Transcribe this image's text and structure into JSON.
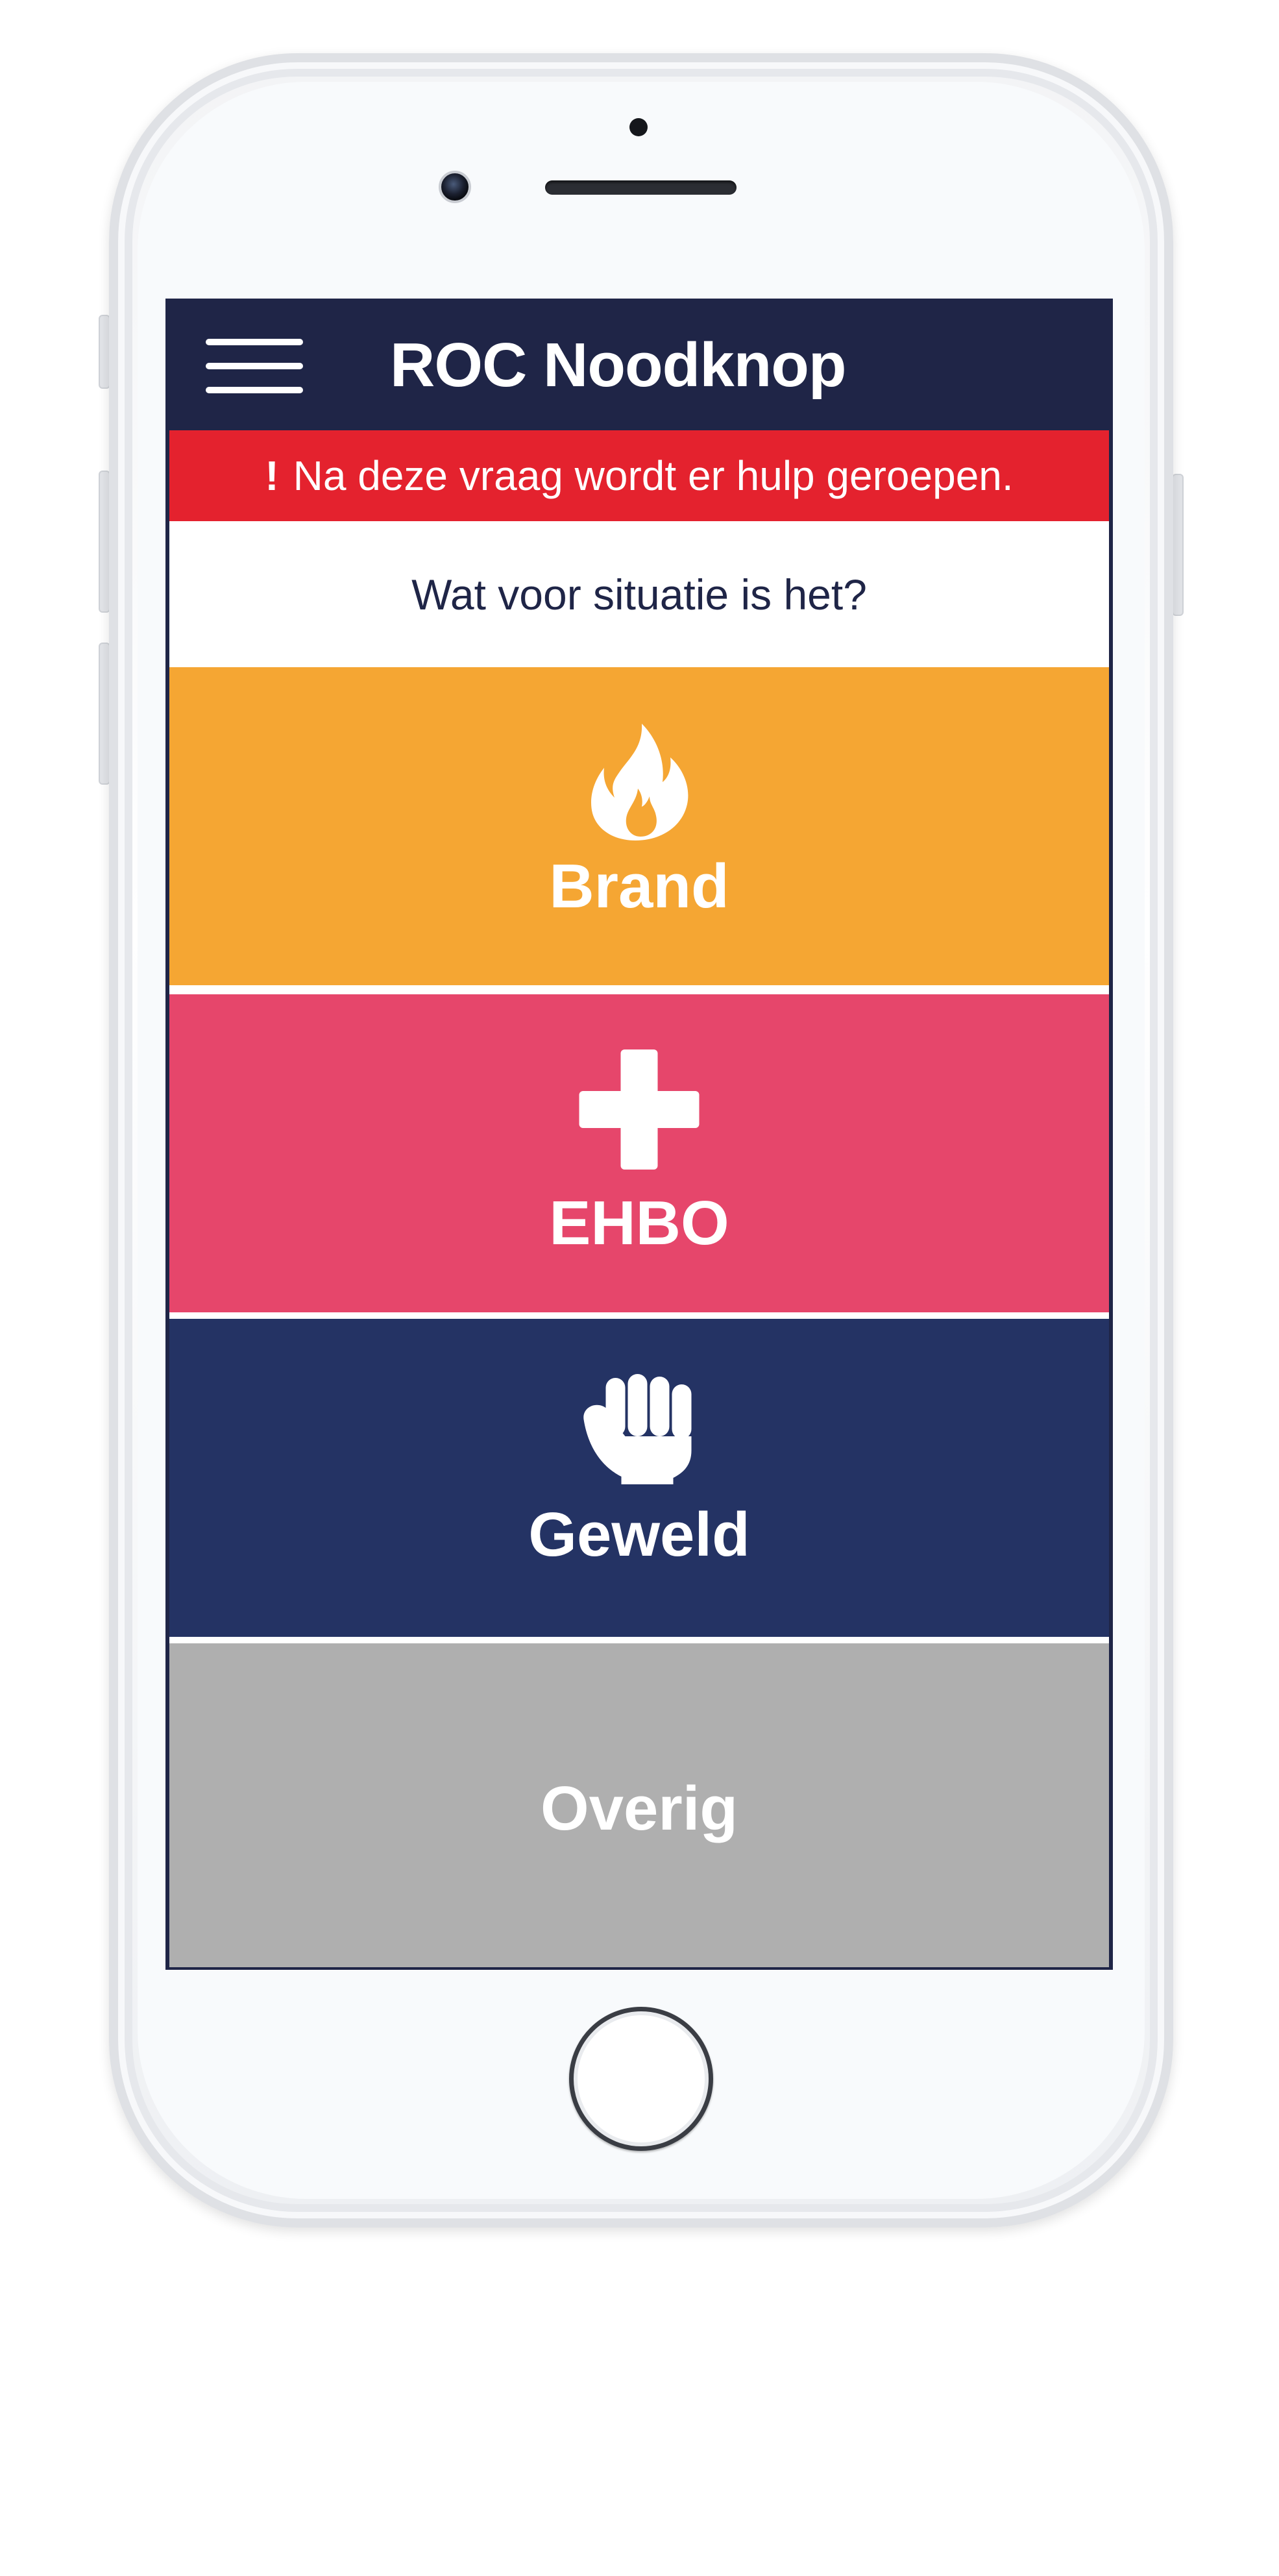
{
  "app": {
    "title": "ROC Noodknop",
    "menu_icon": "hamburger-menu-icon"
  },
  "warning": {
    "mark": "!",
    "text": "Na deze vraag wordt er hulp geroepen."
  },
  "question": "Wat voor situatie is het?",
  "options": [
    {
      "label": "Brand",
      "icon": "fire-icon",
      "color": "#f5a633"
    },
    {
      "label": "EHBO",
      "icon": "plus-icon",
      "color": "#e6466b"
    },
    {
      "label": "Geweld",
      "icon": "fist-icon",
      "color": "#243364"
    },
    {
      "label": "Overig",
      "icon": "",
      "color": "#afafaf"
    }
  ],
  "colors": {
    "app_bar": "#1f2547",
    "warning": "#e4222e",
    "question_text": "#1f2547"
  }
}
